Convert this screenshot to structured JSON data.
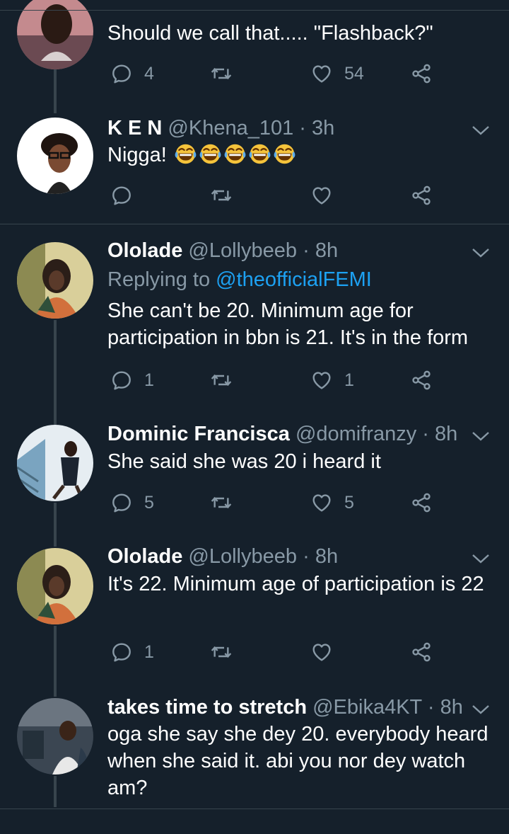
{
  "colors": {
    "background": "#15202b",
    "divider": "#38444d",
    "secondary_text": "#8899a6",
    "link": "#1da1f2"
  },
  "tweets": [
    {
      "body": "Should we call that..... \"Flashback?\"",
      "reply_count": "4",
      "like_count": "54"
    },
    {
      "name": "K E N",
      "handle": "@Khena_101",
      "separator": "·",
      "time": "3h",
      "body": "Nigga! ",
      "emoji": "face-with-tears-of-joy-icon",
      "emoji_count": 5
    },
    {
      "name": "Ololade",
      "handle": "@Lollybeeb",
      "separator": "·",
      "time": "8h",
      "replying_prefix": "Replying to ",
      "replying_to": "@theofficialFEMI",
      "body": "She can't be 20. Minimum age for participation in bbn is 21. It's in the form",
      "reply_count": "1",
      "like_count": "1"
    },
    {
      "name": "Dominic Francisca",
      "handle": "@domifranzy",
      "separator": "·",
      "time": "8h",
      "body": "She said she was 20 i heard it",
      "reply_count": "5",
      "like_count": "5"
    },
    {
      "name": "Ololade",
      "handle": "@Lollybeeb",
      "separator": "·",
      "time": "8h",
      "body": "It's 22. Minimum age of participation is 22",
      "reply_count": "1"
    },
    {
      "name": "takes time to stretch",
      "handle": "@Ebika4KT",
      "separator": "·",
      "time": "8h",
      "body": "oga she say she dey 20. everybody heard when she said it. abi you nor dey watch am?"
    }
  ]
}
